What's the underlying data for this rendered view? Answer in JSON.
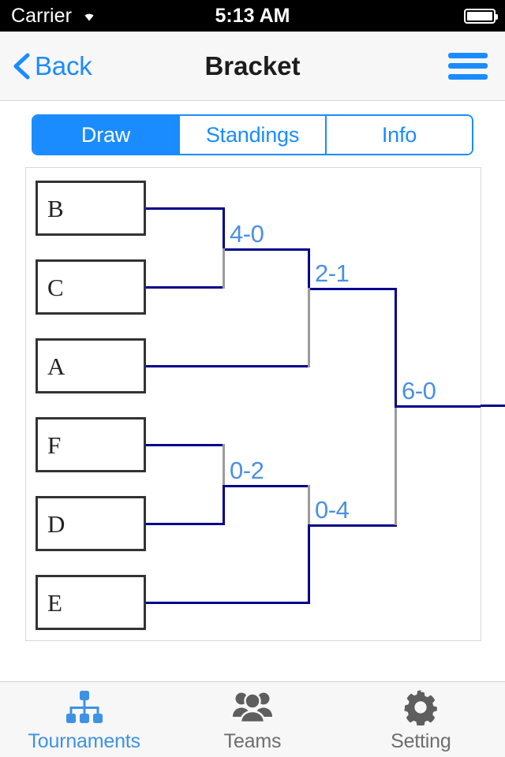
{
  "status_bar": {
    "carrier": "Carrier",
    "wifi_icon": "wifi-icon",
    "time": "5:13 AM",
    "battery_icon": "battery-full-icon"
  },
  "nav_bar": {
    "back_icon": "chevron-left-icon",
    "back_label": "Back",
    "title": "Bracket",
    "menu_icon": "hamburger-menu-icon"
  },
  "segmented_control": {
    "selected_index": 0,
    "tabs": [
      {
        "label": "Draw",
        "selected": true
      },
      {
        "label": "Standings",
        "selected": false
      },
      {
        "label": "Info",
        "selected": false
      }
    ]
  },
  "bracket": {
    "teams": [
      {
        "name": "B"
      },
      {
        "name": "C"
      },
      {
        "name": "A"
      },
      {
        "name": "F"
      },
      {
        "name": "D"
      },
      {
        "name": "E"
      }
    ],
    "scores": [
      {
        "label": "4-0",
        "round": 1,
        "position": "top"
      },
      {
        "label": "2-1",
        "round": 2,
        "position": "top"
      },
      {
        "label": "0-2",
        "round": 1,
        "position": "bottom"
      },
      {
        "label": "0-4",
        "round": 2,
        "position": "bottom"
      },
      {
        "label": "6-0",
        "round": 3,
        "position": "final"
      }
    ],
    "colors": {
      "line": "#00008c",
      "stub": "#9b9b9b",
      "score_text": "#4a90e2",
      "box_border": "#333333"
    }
  },
  "tab_bar": {
    "items": [
      {
        "label": "Tournaments",
        "icon": "org-chart-icon",
        "active": true
      },
      {
        "label": "Teams",
        "icon": "people-group-icon",
        "active": false
      },
      {
        "label": "Setting",
        "icon": "gear-icon",
        "active": false
      }
    ]
  },
  "theme": {
    "accent": "#1a8cff",
    "tab_active": "#3d92e5",
    "tab_inactive": "#6e6e6e"
  }
}
